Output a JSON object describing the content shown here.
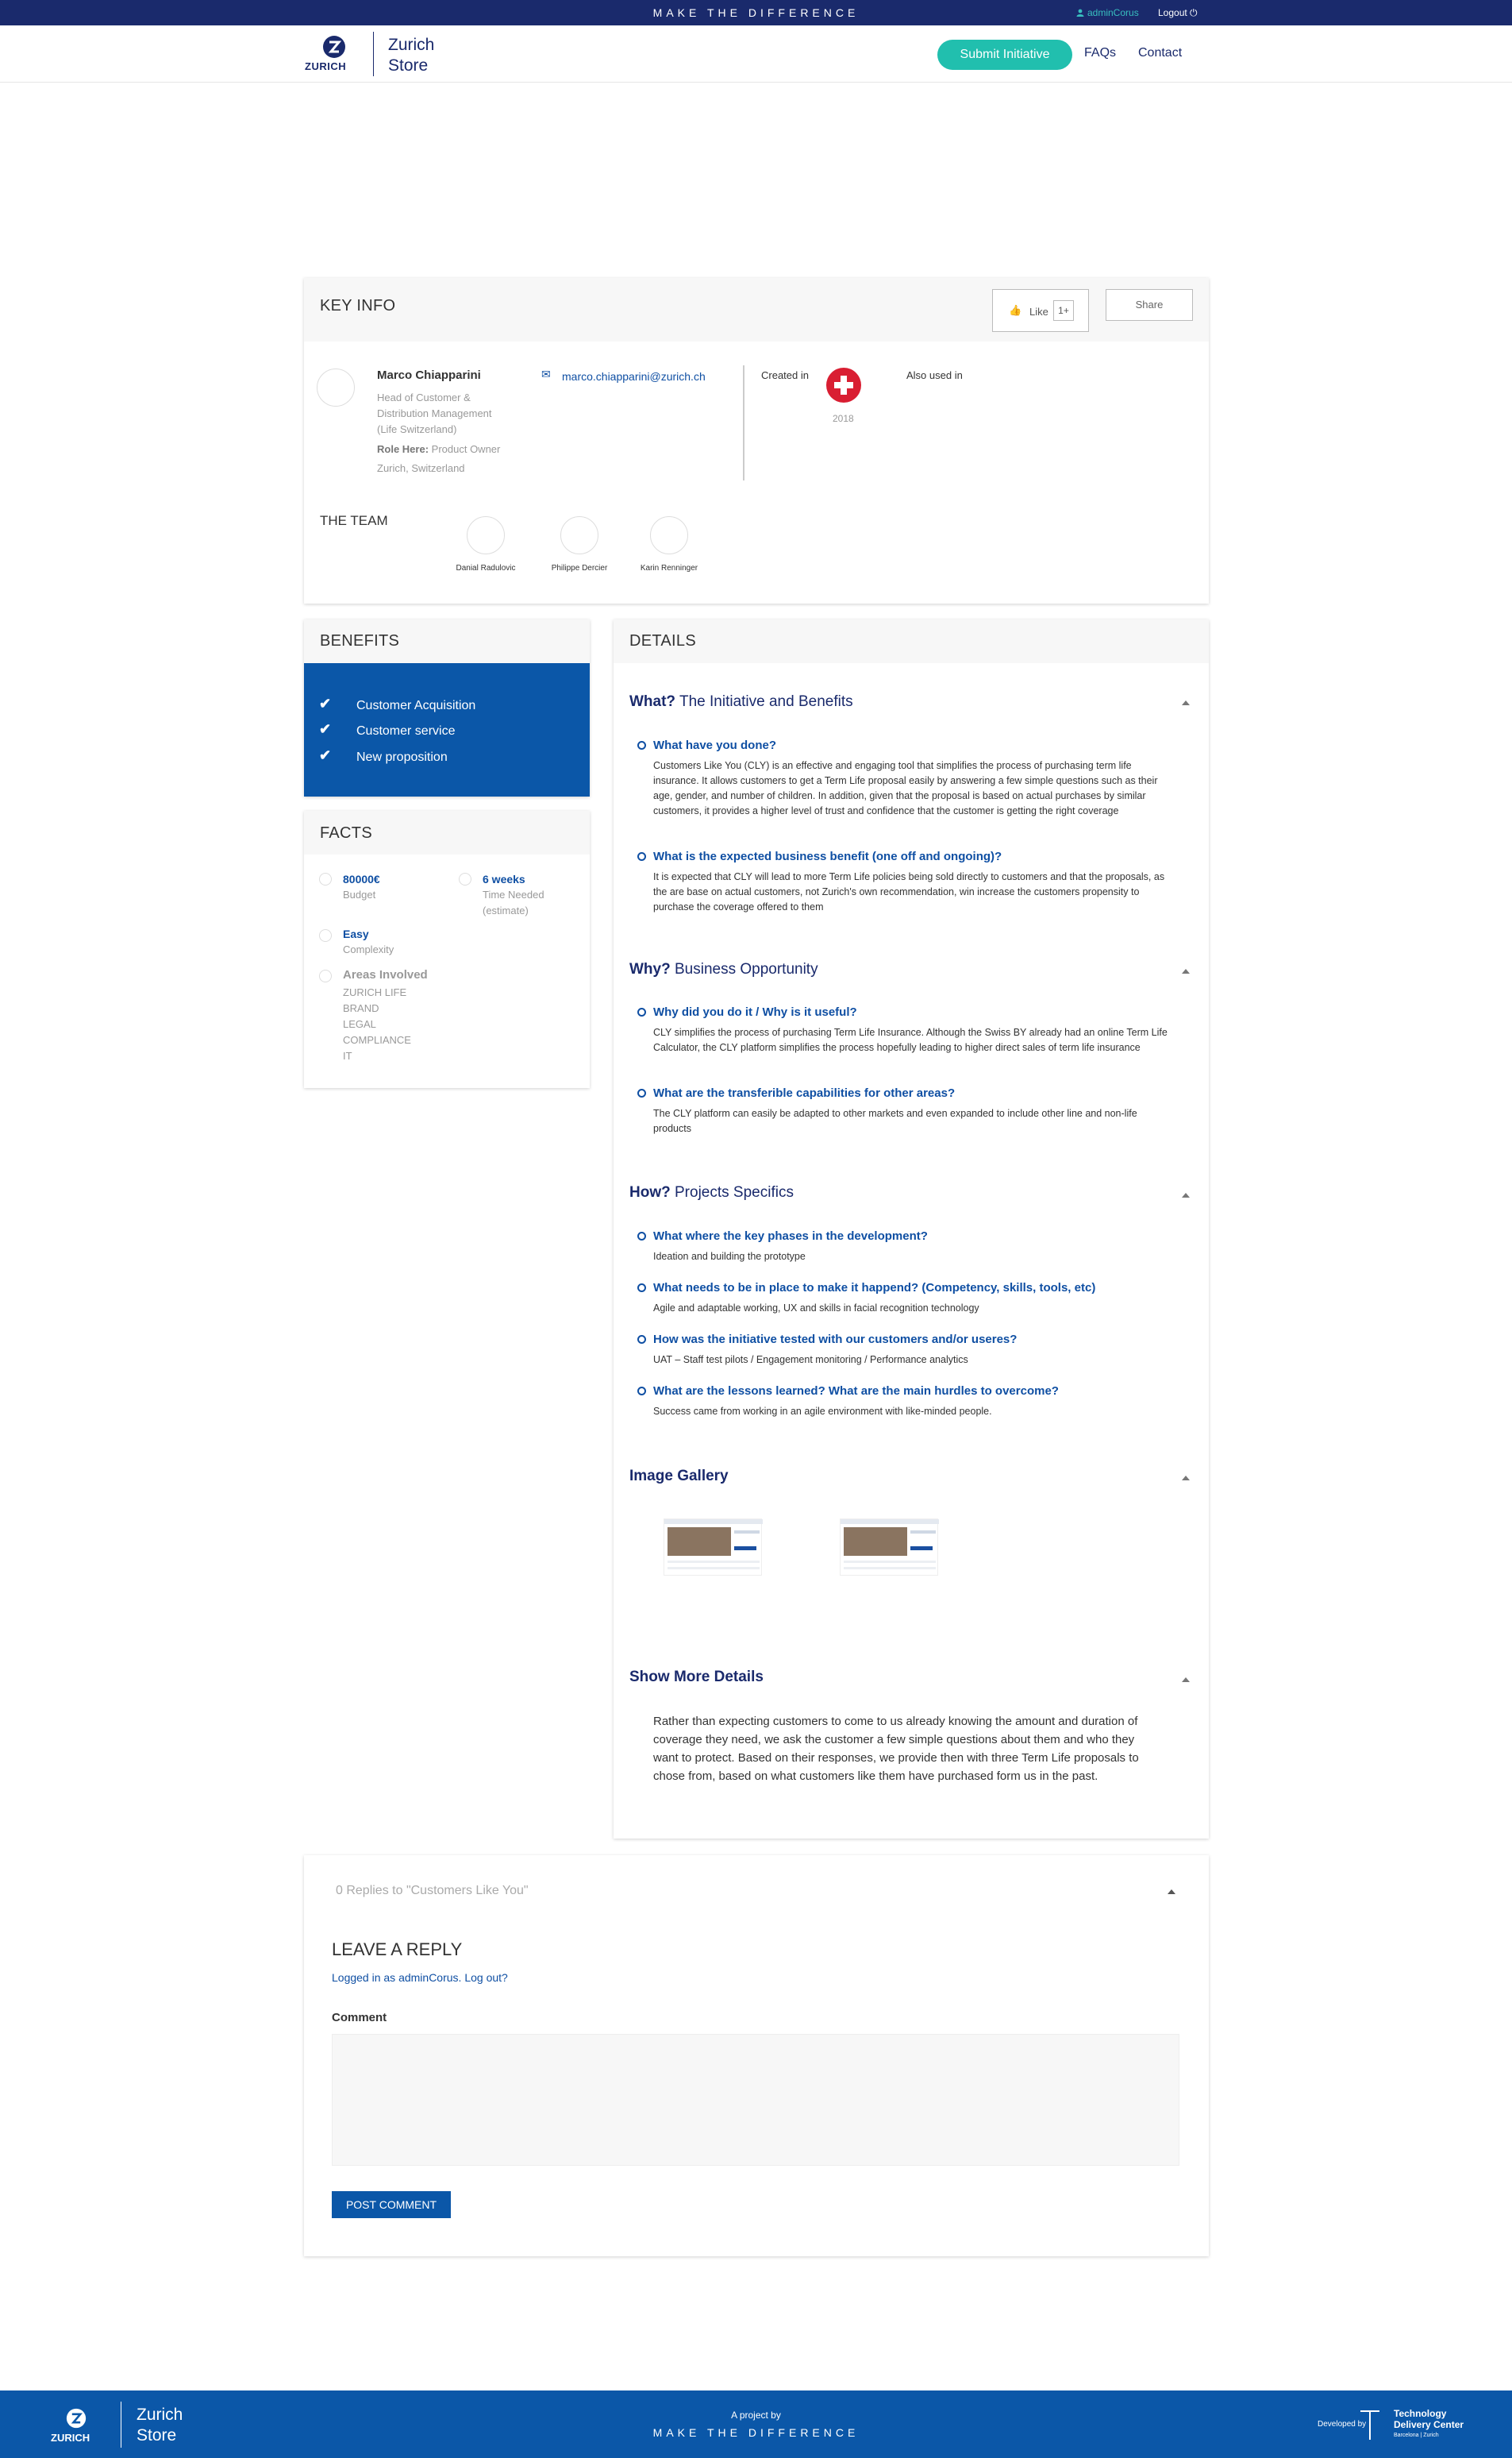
{
  "topbar": {
    "tagline": "MAKE THE DIFFERENCE",
    "username": "adminCorus",
    "logout": "Logout"
  },
  "header": {
    "brand": "ZURICH",
    "store_line1": "Zurich",
    "store_line2": "Store",
    "submit": "Submit Initiative",
    "faqs": "FAQs",
    "contact": "Contact"
  },
  "keyinfo": {
    "title": "KEY INFO",
    "like": "Like",
    "like_count": "1+",
    "share": "Share",
    "owner_name": "Marco Chiapparini",
    "owner_role_lines": [
      "Head of Customer &",
      "Distribution Management",
      "(Life Switzerland)"
    ],
    "role_here_label": "Role Here:",
    "role_here_value": "Product Owner",
    "location": "Zurich, Switzerland",
    "email": "marco.chiapparini@zurich.ch",
    "created_in_label": "Created in",
    "created_year": "2018",
    "also_used_label": "Also used in",
    "team_title": "THE TEAM",
    "team": [
      "Danial Radulovic",
      "Philippe Dercier",
      "Karin Renninger"
    ]
  },
  "benefits": {
    "title": "BENEFITS",
    "items": [
      "Customer Acquisition",
      "Customer service",
      "New proposition"
    ]
  },
  "facts": {
    "title": "FACTS",
    "budget_value": "80000€",
    "budget_label": "Budget",
    "time_value": "6 weeks",
    "time_label_1": "Time Needed",
    "time_label_2": "(estimate)",
    "complexity_value": "Easy",
    "complexity_label": "Complexity",
    "areas_title": "Areas Involved",
    "areas": [
      "ZURICH LIFE",
      "BRAND",
      "LEGAL",
      "COMPLIANCE",
      "IT"
    ]
  },
  "details": {
    "title": "DETAILS",
    "what": {
      "head_bold": "What?",
      "head_rest": " The Initiative and Benefits",
      "q1": "What have you done?",
      "a1": "Customers Like You (CLY) is an effective and engaging tool that simplifies the process of purchasing term life insurance. It allows customers to get a Term Life proposal easily by answering a few simple questions such as their age, gender, and number of children. In addition, given that the proposal is based on actual purchases by similar customers, it provides a higher level of trust and confidence that the customer is getting the right coverage",
      "q2": "What is the expected business benefit (one off and ongoing)?",
      "a2": "It is expected that CLY will lead to more Term Life policies being sold directly to customers and that the proposals, as the are base on actual customers, not Zurich's own recommendation, win increase the customers propensity to purchase the coverage offered to them"
    },
    "why": {
      "head_bold": "Why?",
      "head_rest": " Business Opportunity",
      "q1": "Why did you do it / Why is it useful?",
      "a1": "CLY simplifies the process of purchasing Term Life Insurance. Although the Swiss BY already had an online Term Life Calculator, the CLY platform simplifies the process hopefully leading to higher direct sales of term life insurance",
      "q2": "What are the transferible capabilities for other areas?",
      "a2": "The CLY platform can easily be adapted to other markets and even expanded to include other line and non-life products"
    },
    "how": {
      "head_bold": "How?",
      "head_rest": " Projects Specifics",
      "q1": "What where the key phases in the development?",
      "a1": "Ideation and building the prototype",
      "q2": "What needs to be in place to make it happend? (Competency, skills, tools, etc)",
      "a2": "Agile and adaptable working, UX and skills in facial recognition technology",
      "q3": "How was the initiative tested with our customers and/or useres?",
      "a3": "UAT – Staff test pilots / Engagement monitoring / Performance analytics",
      "q4": "What are the lessons learned? What are the main hurdles to overcome?",
      "a4": "Success came from working in an agile environment with like-minded people."
    },
    "gallery_title": "Image Gallery",
    "more_title": "Show More Details",
    "more_text": "Rather than expecting customers to come to us already knowing the amount and duration of coverage they need, we ask the customer a few simple questions about them and who they want to protect. Based on their responses, we provide then with three Term Life proposals to chose from, based on what customers like them have purchased form us in the past."
  },
  "reply": {
    "count_text": "0 Replies to \"Customers Like You\"",
    "title": "LEAVE A REPLY",
    "logged_in": "Logged in as adminCorus. Log out?",
    "comment_label": "Comment",
    "post": "POST COMMENT"
  },
  "footer": {
    "brand": "ZURICH",
    "store_line1": "Zurich",
    "store_line2": "Store",
    "project_by": "A project by",
    "tagline": "MAKE THE DIFFERENCE",
    "developed_by": "Developed by",
    "tdc_1": "Technology",
    "tdc_2": "Delivery Center",
    "tdc_3": "Barcelona | Zurich"
  }
}
